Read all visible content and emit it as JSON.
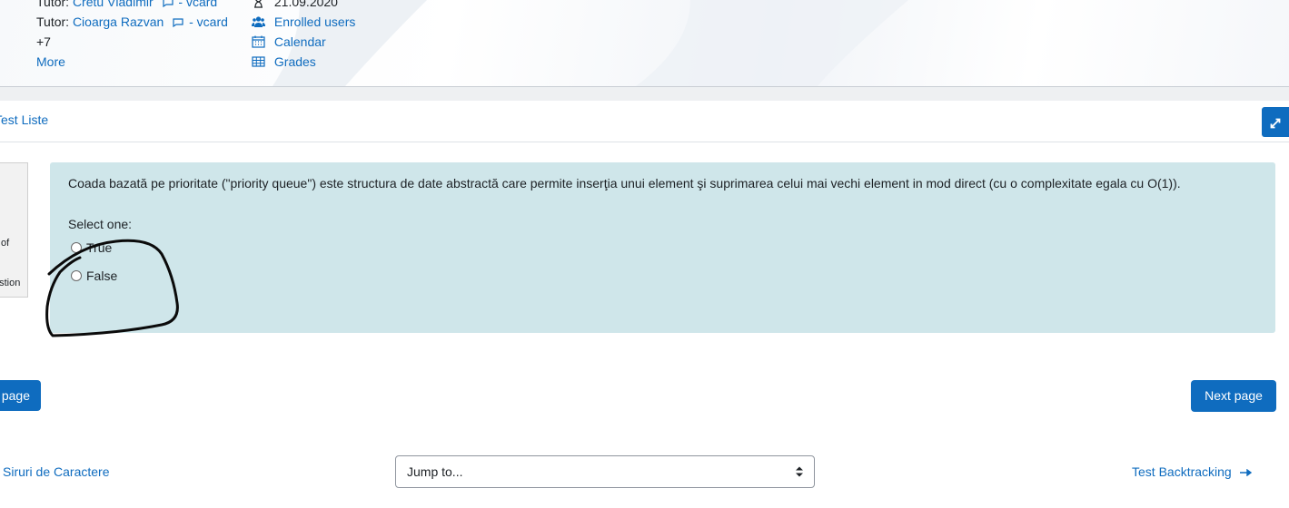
{
  "header": {
    "tutors": [
      {
        "label": "Tutor:",
        "name": "Cretu Vladimir",
        "vcard": "- vcard"
      },
      {
        "label": "Tutor:",
        "name": "Cioarga Razvan",
        "vcard": "- vcard"
      }
    ],
    "more_count": "+7",
    "more_link": "More",
    "course_nav": {
      "date": "21.09.2020",
      "enrolled": "Enrolled users",
      "calendar": "Calendar",
      "grades": "Grades"
    }
  },
  "breadcrumb": "Test Liste",
  "question_info": {
    "line1": "of",
    "line2": "estion"
  },
  "question": {
    "text": "Coada bazată pe prioritate (\"priority queue\") este structura de date abstractă care permite inserţia unui element şi suprimarea celui mai vechi element in mod direct (cu o complexitate egala cu O(1)).",
    "prompt": "Select one:",
    "options": [
      "True",
      "False"
    ]
  },
  "navigation": {
    "prev_button": "page",
    "next_button": "Next page"
  },
  "footer": {
    "prev_activity": "Siruri de Caractere",
    "jump_placeholder": "Jump to...",
    "next_activity": "Test Backtracking"
  },
  "colors": {
    "accent": "#0f6cbf",
    "question_bg": "#cfe6ea"
  }
}
